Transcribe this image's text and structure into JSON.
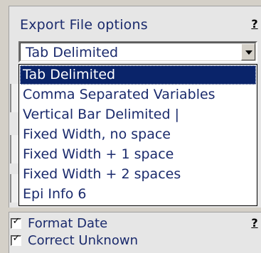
{
  "export_options": {
    "group_title": "Export File options",
    "help_label": "?",
    "selected_format": "Tab Delimited",
    "formats": [
      "Tab Delimited",
      "Comma Separated Variables",
      "Vertical Bar Delimited |",
      "Fixed Width, no space",
      "Fixed Width + 1 space",
      "Fixed Width + 2 spaces",
      "Epi Info 6"
    ],
    "selected_index": 0
  },
  "options": {
    "help_label": "?",
    "format_date": {
      "label": "Format Date",
      "checked": true
    },
    "correct_unknown": {
      "label": "Correct Unknown",
      "checked": true
    }
  },
  "colors": {
    "text": "#1a2a6c",
    "selection": "#0a246a",
    "panel": "#d4d0c8"
  }
}
